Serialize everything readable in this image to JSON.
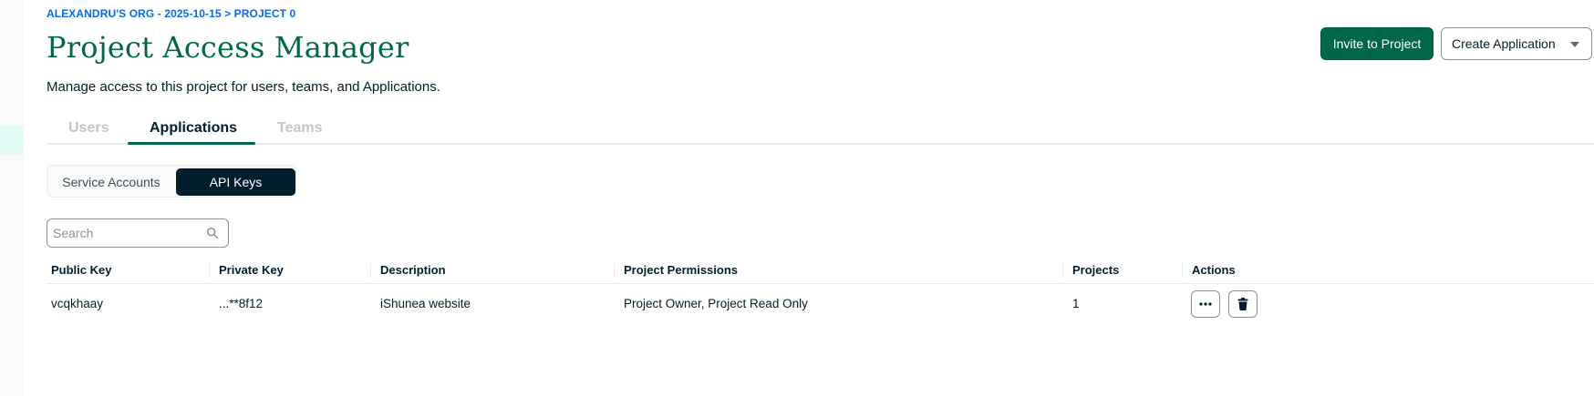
{
  "breadcrumb": "ALEXANDRU'S ORG - 2025-10-15 > PROJECT 0",
  "page_title": "Project Access Manager",
  "subtitle": "Manage access to this project for users, teams, and Applications.",
  "header_actions": {
    "invite_label": "Invite to Project",
    "create_label": "Create Application"
  },
  "tabs": [
    {
      "label": "Users",
      "active": false
    },
    {
      "label": "Applications",
      "active": true
    },
    {
      "label": "Teams",
      "active": false
    }
  ],
  "segmented": {
    "options": [
      "Service Accounts",
      "API Keys"
    ],
    "selected": "API Keys"
  },
  "search": {
    "placeholder": "Search",
    "value": ""
  },
  "table": {
    "columns": [
      "Public Key",
      "Private Key",
      "Description",
      "Project Permissions",
      "Projects",
      "Actions"
    ],
    "rows": [
      {
        "public_key": "vcqkhaay",
        "private_key": "...**8f12",
        "description": "iShunea website",
        "permissions": "Project Owner, Project Read Only",
        "projects": "1"
      }
    ]
  },
  "icons": {
    "search": "search-icon",
    "more": "ellipsis-icon",
    "delete": "trash-icon",
    "dropdown": "caret-down-icon"
  },
  "colors": {
    "brand_green": "#00684a",
    "link_blue": "#016bf8",
    "dark": "#001e2b"
  }
}
